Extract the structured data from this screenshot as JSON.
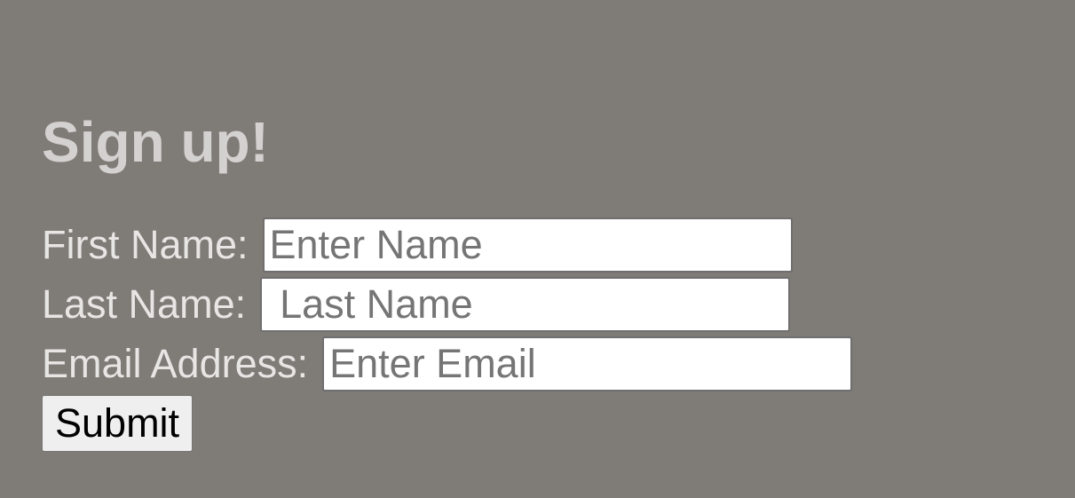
{
  "form": {
    "title": "Sign up!",
    "fields": {
      "first_name": {
        "label": "First Name:",
        "placeholder": "Enter Name",
        "value": ""
      },
      "last_name": {
        "label": "Last Name:",
        "placeholder": "Last Name",
        "value": ""
      },
      "email": {
        "label": "Email Address:",
        "placeholder": "Enter Email",
        "value": ""
      }
    },
    "submit_label": "Submit"
  },
  "colors": {
    "background": "#7f7b76",
    "heading": "#d4d2d1",
    "label": "#e8e6e5",
    "input_background": "#ffffff",
    "button_background": "#efefef"
  }
}
